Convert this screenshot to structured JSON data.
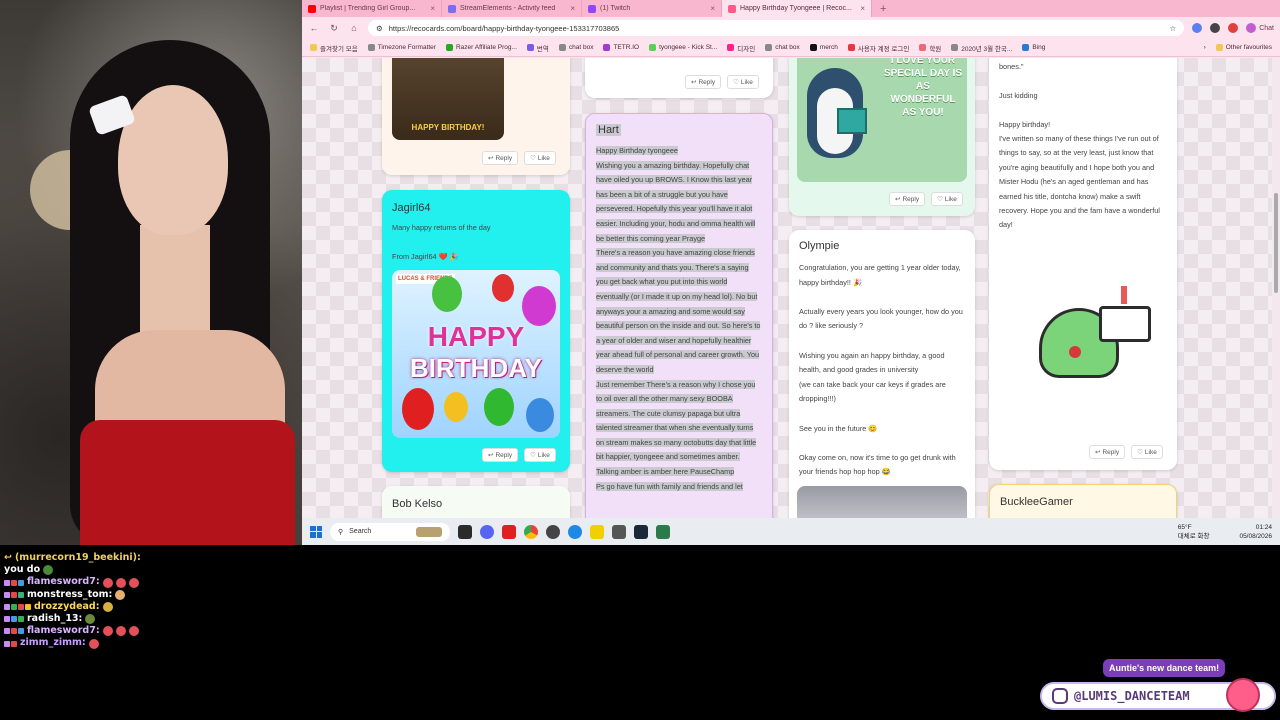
{
  "browser": {
    "tabs": [
      {
        "label": "Playlist | Trending Girl Group...",
        "color": "#ff0000"
      },
      {
        "label": "StreamElements - Activity feed",
        "color": "#7c6cf0"
      },
      {
        "label": "(1) Twitch",
        "color": "#9146ff"
      },
      {
        "label": "Happy Birthday Tyongeee | Recoc...",
        "color": "#ff5a8a",
        "active": true
      }
    ],
    "url": "https://recocards.com/board/happy-birthday-tyongeee-153317703865",
    "chat_label": "Chat",
    "bookmarks": [
      "즐겨찾기 모음",
      "Timezone Formatter",
      "Razer Affiliate Prog...",
      "번역",
      "chat box",
      "TETR.IO",
      "tyongeee - Kick St...",
      "디자인",
      "chat box",
      "merch",
      "사용자 계정 로그인",
      "학원",
      "2020년 3월 한국...",
      "Bing"
    ],
    "other_favourites": "Other favourites"
  },
  "cards": {
    "top_left": {
      "img_text": "HAPPY BIRTHDAY!",
      "reply": "Reply",
      "like": "Like"
    },
    "top_mid": {
      "reply": "Reply",
      "like": "Like"
    },
    "penguin": {
      "img_text": "I LOVE YOUR SPECIAL DAY IS AS WONDERFUL AS YOU!",
      "reply": "Reply",
      "like": "Like"
    },
    "jagirl": {
      "name": "Jagirl64",
      "line1": "Many happy returns of the day",
      "line2": "From Jagirl64 ❤️ 🎉",
      "img_brand": "LUCAS & FRIENDS",
      "img_text1": "HAPPY",
      "img_text2": "BIRTHDAY",
      "reply": "Reply",
      "like": "Like"
    },
    "hart": {
      "name": "Hart",
      "body": "Happy Birthday tyongeee\nWishing you a amazing birthday. Hopefully chat have oiled you up BROWS. I Know this last year has been a bit of a struggle but you have persevered. Hopefully this year you'll have it alot easier. Including your, hodu and omma health will be better this coming year Prayge\nThere's a reason you have amazing close friends and community and thats you. There's a saying you get back what you put into this world eventually (or I made it up on my head lol). No but anyways your a amazing and some would say beautiful person on the inside and out. So here's to a year of older and wiser and hopefully healthier year ahead full of personal and career growth. You deserve the world\nJust remember There's a reason why I chose you to oil over all the other many sexy BOOBA streamers. The cute clumsy papaga but ultra talented streamer that when she eventually turns on stream makes so many octobutts day that little bit happier, tyongeee and sometimes amber. Talking amber is amber here PauseChamp\nPs go have fun with family and friends and let"
    },
    "olympie": {
      "name": "Olympie",
      "body": "Congratulation, you are getting 1 year older today, happy birthday!! 🎉\n\nActually every years you look younger, how do you do ? like seriously ?\n\nWishing you again an happy birthday, a good health, and good grades in university\n(we can take back your car keys if grades are dropping!!!)\n\nSee you in the future 😊\n\nOkay come on, now it's time to go get drunk with your friends hop hop hop 😂"
    },
    "long_right": {
      "body": "bones.\"\n\nJust kidding\n\nHappy birthday!\nI've written so many of these things I've run out of things to say, so at the very least, just know that you're aging beautifully and I hope both you and Mister Hodu (he's an aged gentleman and has earned his title, dontcha know) make a swift recovery. Hope you and the fam have a wonderful day!",
      "reply": "Reply",
      "like": "Like"
    },
    "bob": {
      "name": "Bob Kelso"
    },
    "bucklee": {
      "name": "BuckleeGamer"
    }
  },
  "taskbar": {
    "search": "Search",
    "weather_temp": "65°F",
    "weather_desc": "대체로 화창",
    "time": "01:24",
    "date": "05/08/2026"
  },
  "chat": [
    {
      "user": "(murrecorn19_beekini):",
      "msg": "you do",
      "color": "#f0d060",
      "reply": true
    },
    {
      "user": "flamesword7:",
      "msg": "",
      "color": "#d8b4ff"
    },
    {
      "user": "monstress_tom:",
      "msg": "",
      "color": "#ffffff"
    },
    {
      "user": "drozzydead:",
      "msg": "",
      "color": "#ffd75a"
    },
    {
      "user": "radish_13:",
      "msg": "",
      "color": "#ffffff"
    },
    {
      "user": "flamesword7:",
      "msg": "",
      "color": "#d8b4ff"
    },
    {
      "user": "zimm_zimm:",
      "msg": "",
      "color": "#c8a0ff"
    }
  ],
  "overlay": {
    "tag": "Auntie's new dance team!",
    "handle": "@LUMIS_DANCETEAM"
  }
}
